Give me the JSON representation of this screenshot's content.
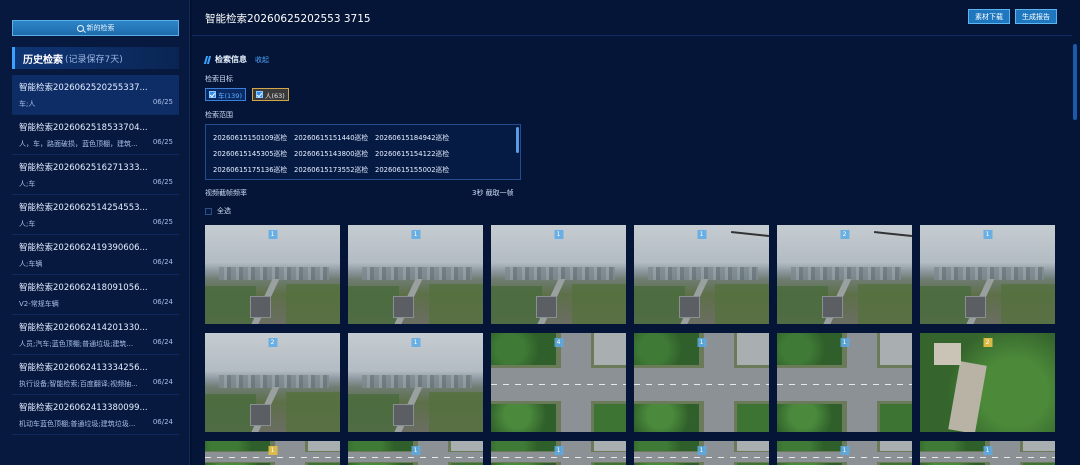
{
  "sidebar": {
    "new_search_label": "新的检索",
    "history_title": "历史检索",
    "history_subtitle": "(记录保存7天)",
    "items": [
      {
        "name": "智能检索2026062520255337...",
        "tags": "车;人",
        "date": "06/25"
      },
      {
        "name": "智能检索2026062518533704...",
        "tags": "人，车，路面破损，蓝色顶棚，建筑...",
        "date": "06/25"
      },
      {
        "name": "智能检索2026062516271333...",
        "tags": "人;车",
        "date": "06/25"
      },
      {
        "name": "智能检索2026062514254553...",
        "tags": "人;车",
        "date": "06/25"
      },
      {
        "name": "智能检索2026062419390606...",
        "tags": "人;车辆",
        "date": "06/24"
      },
      {
        "name": "智能检索2026062418091056...",
        "tags": "V2-常规车辆",
        "date": "06/24"
      },
      {
        "name": "智能检索2026062414201330...",
        "tags": "人员;汽车;蓝色顶棚;普通垃圾;建筑...",
        "date": "06/24"
      },
      {
        "name": "智能检索2026062413334256...",
        "tags": "执行设备;智能检索;百度翻译;视频抽...",
        "date": "06/24"
      },
      {
        "name": "智能检索2026062413380099...",
        "tags": "机动车蓝色顶棚;普通垃圾;建筑垃圾...",
        "date": "06/24"
      }
    ]
  },
  "header": {
    "title": "智能检索20260625202553 3715",
    "download_label": "素材下载",
    "generate_label": "生成报告"
  },
  "info": {
    "section_title": "检索信息",
    "collapse_label": "收起",
    "target_label": "检索目标",
    "target_car": "车(139)",
    "target_person": "人(63)",
    "range_label": "检索范围",
    "range_rows": [
      [
        "20260615150109巡检",
        "20260615151440巡检",
        "20260615184942巡检"
      ],
      [
        "20260615145305巡检",
        "20260615143800巡检",
        "20260615154122巡检"
      ],
      [
        "20260615175136巡检",
        "20260615173552巡检",
        "20260615155002巡检"
      ]
    ],
    "freq_label": "视频截帧频率",
    "freq_value": "3秒  截取一帧",
    "select_all_label": "全选"
  },
  "thumbnails": [
    {
      "badge": "1",
      "scene": "city",
      "badge_color": "blue"
    },
    {
      "badge": "1",
      "scene": "city",
      "badge_color": "blue"
    },
    {
      "badge": "1",
      "scene": "city",
      "badge_color": "blue"
    },
    {
      "badge": "1",
      "scene": "city-wing",
      "badge_color": "blue"
    },
    {
      "badge": "2",
      "scene": "city-wing",
      "badge_color": "blue"
    },
    {
      "badge": "1",
      "scene": "city",
      "badge_color": "blue"
    },
    {
      "badge": "2",
      "scene": "city",
      "badge_color": "blue"
    },
    {
      "badge": "1",
      "scene": "city",
      "badge_color": "blue"
    },
    {
      "badge": "4",
      "scene": "street",
      "badge_color": "blue"
    },
    {
      "badge": "1",
      "scene": "street",
      "badge_color": "blue"
    },
    {
      "badge": "1",
      "scene": "street",
      "badge_color": "blue"
    },
    {
      "badge": "2",
      "scene": "park",
      "badge_color": "yellow"
    },
    {
      "badge": "1",
      "scene": "street",
      "badge_color": "yellow"
    },
    {
      "badge": "1",
      "scene": "street",
      "badge_color": "blue"
    },
    {
      "badge": "1",
      "scene": "street",
      "badge_color": "blue"
    },
    {
      "badge": "1",
      "scene": "street",
      "badge_color": "blue"
    },
    {
      "badge": "1",
      "scene": "street",
      "badge_color": "blue"
    },
    {
      "badge": "1",
      "scene": "street",
      "badge_color": "blue"
    }
  ],
  "colors": {
    "background": "#03102b",
    "sidebar": "#07193f",
    "accent": "#3aa3ff",
    "button": "#1f78bf"
  }
}
